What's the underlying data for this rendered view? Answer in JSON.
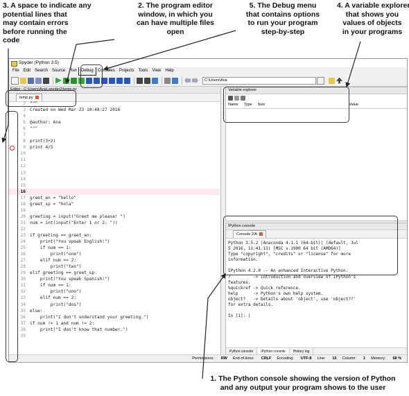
{
  "callouts": {
    "c1": [
      "3. A space to indicate any",
      "potential lines that",
      "may contain errors",
      "before running the",
      "code"
    ],
    "c2": [
      "2. The program editor",
      "window, in which you",
      "can have multiple files",
      "open"
    ],
    "c3": [
      "5. The Debug menu",
      "that contains options",
      "to run your program",
      "step-by-step"
    ],
    "c4": [
      "4. A variable explorer",
      "that shows you",
      "values of objects",
      "in your programs"
    ],
    "c5": [
      "1. The Python console showing the version of Python",
      "and any output your program shows to the user"
    ]
  },
  "window": {
    "title": "Spyder (Python 3.5)",
    "menu": [
      "File",
      "Edit",
      "Search",
      "Source",
      "Run",
      "Debug",
      "Consoles",
      "Projects",
      "Tools",
      "View",
      "Help"
    ],
    "path": "C:\\Users\\Ana"
  },
  "editor": {
    "title": "Editor - C:\\Users\\Ana\\.spyder2\\temp.py",
    "tab": "temp.py",
    "current_line": 16,
    "breakpoint_line": 9,
    "lines": [
      {
        "n": "2",
        "t": "\"\"\"",
        "c": "st"
      },
      {
        "n": "3",
        "t": "Created on Wed Mar 23 10:48:27 2016",
        "c": "st"
      },
      {
        "n": "4",
        "t": "",
        "c": ""
      },
      {
        "n": "5",
        "t": "@author: Ana",
        "c": "st"
      },
      {
        "n": "6",
        "t": "\"\"\"",
        "c": "st"
      },
      {
        "n": "7",
        "t": "",
        "c": ""
      },
      {
        "n": "8",
        "t": "print(3+2)",
        "c": "kw"
      },
      {
        "n": "9",
        "t": "print 4/5",
        "c": "kw"
      },
      {
        "n": "10",
        "t": "",
        "c": ""
      },
      {
        "n": "11",
        "t": "",
        "c": ""
      },
      {
        "n": "12",
        "t": "",
        "c": ""
      },
      {
        "n": "13",
        "t": "",
        "c": ""
      },
      {
        "n": "14",
        "t": "",
        "c": ""
      },
      {
        "n": "15",
        "t": "",
        "c": ""
      },
      {
        "n": "16",
        "t": "",
        "c": ""
      },
      {
        "n": "17",
        "t": "greet_en = \"hello\"",
        "c": ""
      },
      {
        "n": "18",
        "t": "greet_sp = \"hola\"",
        "c": ""
      },
      {
        "n": "19",
        "t": "",
        "c": ""
      },
      {
        "n": "20",
        "t": "greeting = input(\"Greet me please! \")",
        "c": ""
      },
      {
        "n": "21",
        "t": "num = int(input(\"Enter 1 or 2: \"))",
        "c": ""
      },
      {
        "n": "22",
        "t": "",
        "c": ""
      },
      {
        "n": "23",
        "t": "if greeting == greet_en:",
        "c": ""
      },
      {
        "n": "24",
        "t": "    print(\"You speak English!\")",
        "c": ""
      },
      {
        "n": "25",
        "t": "    if num == 1:",
        "c": ""
      },
      {
        "n": "26",
        "t": "        print(\"one\")",
        "c": ""
      },
      {
        "n": "27",
        "t": "    elif num == 2:",
        "c": ""
      },
      {
        "n": "28",
        "t": "        print(\"two\")",
        "c": ""
      },
      {
        "n": "29",
        "t": "elif greeting == greet_sp:",
        "c": ""
      },
      {
        "n": "30",
        "t": "    print(\"You speak Spanish!\")",
        "c": ""
      },
      {
        "n": "31",
        "t": "    if num == 1:",
        "c": ""
      },
      {
        "n": "32",
        "t": "        print(\"uno\")",
        "c": ""
      },
      {
        "n": "33",
        "t": "    elif num == 2:",
        "c": ""
      },
      {
        "n": "34",
        "t": "        print(\"dos\")",
        "c": ""
      },
      {
        "n": "35",
        "t": "else:",
        "c": ""
      },
      {
        "n": "36",
        "t": "    print(\"I don't understand your greeting.\")",
        "c": ""
      },
      {
        "n": "37",
        "t": "if num != 1 and num != 2:",
        "c": ""
      },
      {
        "n": "38",
        "t": "    print(\"I don't know that number.\")",
        "c": ""
      },
      {
        "n": "39",
        "t": "",
        "c": ""
      }
    ]
  },
  "variable_explorer": {
    "title": "Variable explorer",
    "columns": [
      "Name",
      "Type",
      "Size",
      "Value"
    ]
  },
  "console": {
    "title": "IPython console",
    "tab": "Console 2/A",
    "text": "Python 3.5.2 |Anaconda 4.1.1 (64-bit)| (default, Jul\n5 2016, 11:41:13) [MSC v.1900 64 bit (AMD64)]\nType \"copyright\", \"credits\" or \"license\" for more\ninformation.\n\nIPython 4.2.0 -- An enhanced Interactive Python.\n?         -> Introduction and overview of IPython's\nfeatures.\n%quickref -> Quick reference.\nhelp      -> Python's own help system.\nobject?   -> Details about 'object', use 'object??'\nfor extra details.\n\nIn [1]: |",
    "bottom_tabs": [
      "Python console",
      "IPython console",
      "History log"
    ]
  },
  "status": {
    "permissions_label": "Permissions:",
    "permissions": "RW",
    "eol_label": "End-of-lines:",
    "eol": "CRLF",
    "encoding_label": "Encoding:",
    "encoding": "UTF-8",
    "line_label": "Line:",
    "line": "15",
    "column_label": "Column:",
    "column": "1",
    "memory_label": "Memory:",
    "memory": "68 %"
  }
}
